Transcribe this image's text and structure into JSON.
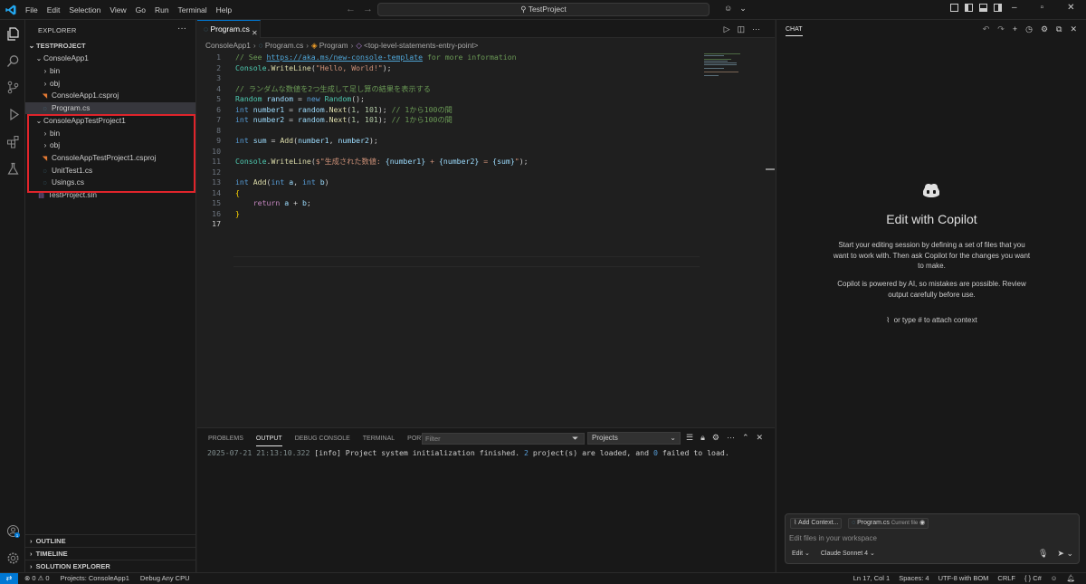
{
  "menu": [
    "File",
    "Edit",
    "Selection",
    "View",
    "Go",
    "Run",
    "Terminal",
    "Help"
  ],
  "command_center": "TestProject",
  "explorer": {
    "header": "EXPLORER",
    "root": "TESTPROJECT",
    "items": [
      {
        "label": "ConsoleApp1",
        "chevron": "⌄"
      },
      {
        "label": "bin",
        "chevron": "›"
      },
      {
        "label": "obj",
        "chevron": "›"
      },
      {
        "label": "ConsoleApp1.csproj",
        "icon": "rss"
      },
      {
        "label": "Program.cs",
        "icon": "cs"
      },
      {
        "label": "ConsoleAppTestProject1",
        "chevron": "⌄"
      },
      {
        "label": "bin",
        "chevron": "›"
      },
      {
        "label": "obj",
        "chevron": "›"
      },
      {
        "label": "ConsoleAppTestProject1.csproj",
        "icon": "rss"
      },
      {
        "label": "UnitTest1.cs",
        "icon": "cs"
      },
      {
        "label": "Usings.cs",
        "icon": "cs"
      },
      {
        "label": "TestProject.sln",
        "icon": "sln"
      }
    ],
    "sections": [
      "OUTLINE",
      "TIMELINE",
      "SOLUTION EXPLORER"
    ]
  },
  "editor": {
    "tab": "Program.cs",
    "breadcrumbs": [
      "ConsoleApp1",
      "Program.cs",
      "Program",
      "<top-level-statements-entry-point>"
    ],
    "line_numbers": [
      "1",
      "2",
      "3",
      "4",
      "5",
      "6",
      "7",
      "8",
      "9",
      "10",
      "11",
      "12",
      "13",
      "14",
      "15",
      "16",
      "17"
    ],
    "code": {
      "l1_comment": "// See ",
      "l1_link": "https://aka.ms/new-console-template",
      "l1_rest": " for more information",
      "l2_type": "Console",
      "l2_fn": "WriteLine",
      "l2_str": "\"Hello, World!\"",
      "l4_comment": "// ランダムな数値を2つ生成して足し算の結果を表示する",
      "l5_type": "Random",
      "l5_var": "random",
      "l5_kw": "new",
      "l5_type2": "Random",
      "l6_kw": "int",
      "l6_var": "number1",
      "l6_var2": "random",
      "l6_fn": "Next",
      "l6_n1": "1",
      "l6_n2": "101",
      "l6_comment": "// 1から100の間",
      "l7_kw": "int",
      "l7_var": "number2",
      "l7_var2": "random",
      "l7_fn": "Next",
      "l7_n1": "1",
      "l7_n2": "101",
      "l7_comment": "// 1から100の間",
      "l9_kw": "int",
      "l9_var": "sum",
      "l9_fn": "Add",
      "l9_a1": "number1",
      "l9_a2": "number2",
      "l11_type": "Console",
      "l11_fn": "WriteLine",
      "l11_str1": "$\"生成された数値: ",
      "l11_i1": "{number1}",
      "l11_s2": " + ",
      "l11_i2": "{number2}",
      "l11_s3": " = ",
      "l11_i3": "{sum}",
      "l11_s4": "\"",
      "l13_kw": "int",
      "l13_fn": "Add",
      "l13_kw2": "int",
      "l13_a": "a",
      "l13_kw3": "int",
      "l13_b": "b",
      "l14": "{",
      "l15_kw": "return",
      "l15_a": "a",
      "l15_b": "b",
      "l16": "}"
    }
  },
  "panel": {
    "tabs": [
      "PROBLEMS",
      "OUTPUT",
      "DEBUG CONSOLE",
      "TERMINAL",
      "PORTS"
    ],
    "active_tab": "OUTPUT",
    "filter_placeholder": "Filter",
    "channel": "Projects",
    "output": {
      "time": "2025-07-21 21:13:10.322",
      "part1": " [info] Project system initialization finished. ",
      "n1": "2",
      "part2": " project(s) are loaded, and ",
      "n2": "0",
      "part3": " failed to load."
    }
  },
  "chat": {
    "header": "CHAT",
    "title": "Edit with Copilot",
    "intro": "Start your editing session by defining a set of files that you want to work with. Then ask Copilot for the changes you want to make.",
    "disclaimer": "Copilot is powered by AI, so mistakes are possible. Review output carefully before use.",
    "attach_hint": "or type # to attach context",
    "add_context": "Add Context...",
    "file_chip": "Program.cs",
    "file_chip_note": "Current file",
    "input_placeholder": "Edit files in your workspace",
    "mode": "Edit",
    "model": "Claude Sonnet 4"
  },
  "statusbar": {
    "problems": "⊗ 0  ⚠ 0",
    "projects": "Projects: ConsoleApp1",
    "debug": "Debug Any CPU",
    "position": "Ln 17, Col 1",
    "spaces": "Spaces: 4",
    "encoding": "UTF-8 with BOM",
    "eol": "CRLF",
    "language": "C#"
  },
  "accounts_badge": "1",
  "colors": {
    "accent": "#0078d4",
    "highlight_box": "#e0242b"
  }
}
